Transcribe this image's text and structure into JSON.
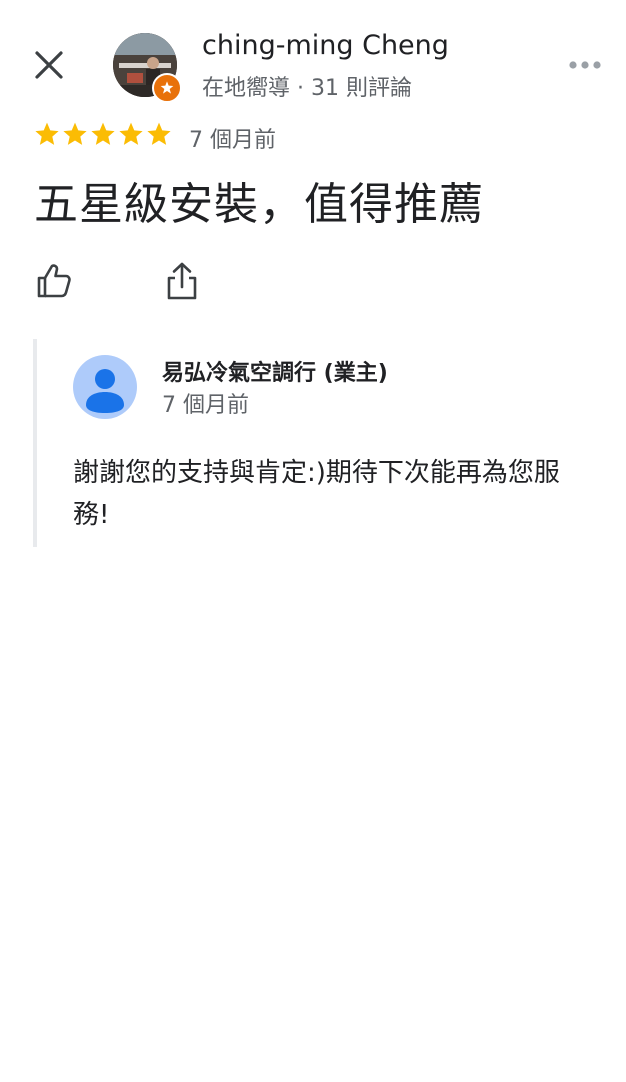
{
  "header": {
    "author_name": "ching-ming Cheng",
    "author_meta": "在地嚮導 · 31 則評論",
    "icons": {
      "close": "close-icon",
      "more": "more-horizontal-icon",
      "badge": "local-guide-star-icon"
    }
  },
  "review": {
    "rating": 5,
    "rating_max": 5,
    "time": "7 個月前",
    "text": "五星級安裝，值得推薦"
  },
  "actions": {
    "icons": {
      "like": "thumbs-up-icon",
      "share": "share-icon"
    }
  },
  "owner_reply": {
    "name": "易弘冷氣空調行 (業主)",
    "time": "7 個月前",
    "text": "謝謝您的支持與肯定:)期待下次能再為您服務!"
  },
  "colors": {
    "star": "#fbbc04",
    "badge": "#e8710a",
    "owner_avatar_bg": "#aecbfa",
    "owner_avatar_fg": "#1a73e8",
    "reply_border": "#e8eaed"
  }
}
